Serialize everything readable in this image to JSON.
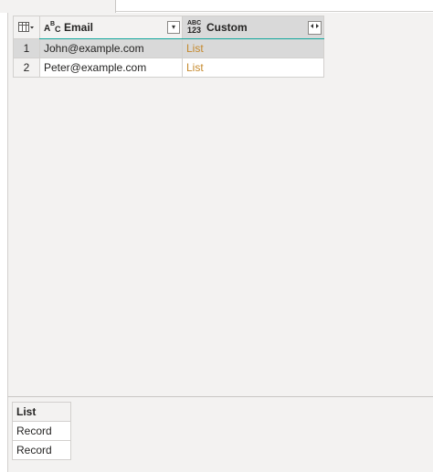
{
  "grid": {
    "columns": [
      {
        "type_icon": "ABC",
        "label": "Email",
        "menu_icon": "dropdown-arrow-icon"
      },
      {
        "type_icon": "ABC 123",
        "label": "Custom",
        "menu_icon": "expand-icon"
      }
    ],
    "rows": [
      {
        "num": "1",
        "email": "John@example.com",
        "custom": "List"
      },
      {
        "num": "2",
        "email": "Peter@example.com",
        "custom": "List"
      }
    ]
  },
  "preview": {
    "header": "List",
    "items": [
      "Record",
      "Record"
    ]
  },
  "colors": {
    "accent_bar": "#12a89d",
    "list_value": "#c5892c",
    "selection": "#d9d9d9"
  }
}
